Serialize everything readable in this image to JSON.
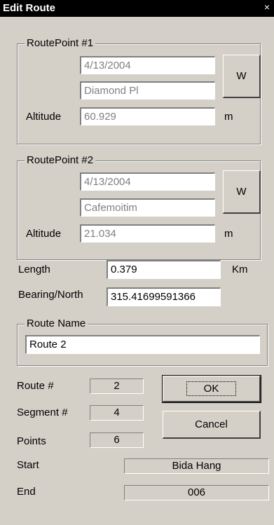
{
  "window": {
    "title": "Edit Route",
    "close_glyph": "×"
  },
  "routepoint1": {
    "legend": "RoutePoint #1",
    "date": "4/13/2004",
    "name": "Diamond Pl",
    "altitude_label": "Altitude",
    "altitude": "60.929",
    "unit": "m",
    "w_button": "W"
  },
  "routepoint2": {
    "legend": "RoutePoint #2",
    "date": "4/13/2004",
    "name": "Cafemoitim",
    "altitude_label": "Altitude",
    "altitude": "21.034",
    "unit": "m",
    "w_button": "W"
  },
  "length": {
    "label": "Length",
    "value": "0.379",
    "unit": "Km"
  },
  "bearing": {
    "label": "Bearing/North",
    "value": "315.41699591366"
  },
  "route_name": {
    "legend": "Route Name",
    "value": "Route  2"
  },
  "info": {
    "route_label": "Route #",
    "route_value": "2",
    "segment_label": "Segment #",
    "segment_value": "4",
    "points_label": "Points",
    "points_value": "6",
    "start_label": "Start",
    "start_value": "Bida Hang",
    "end_label": "End",
    "end_value": "006"
  },
  "buttons": {
    "ok": "OK",
    "cancel": "Cancel"
  }
}
